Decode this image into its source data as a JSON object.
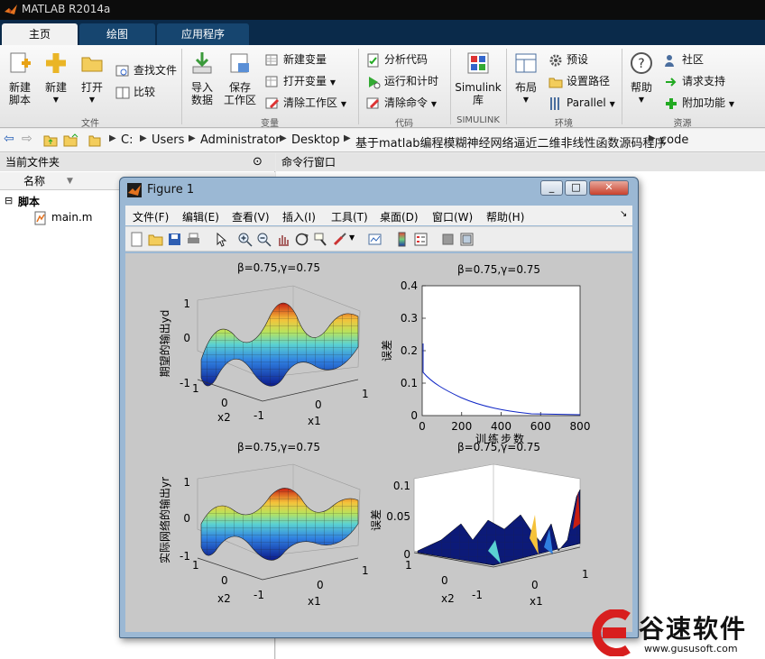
{
  "window": {
    "title": "MATLAB R2014a"
  },
  "tabs": [
    "主页",
    "绘图",
    "应用程序"
  ],
  "ribbon": {
    "new_script": "新建\n脚本",
    "new": "新建",
    "open": "打开",
    "find_files": "查找文件",
    "compare": "比较",
    "import_data": "导入\n数据",
    "save_workspace": "保存\n工作区",
    "new_variable": "新建变量",
    "open_variable": "打开变量",
    "clear_workspace": "清除工作区",
    "analyze_code": "分析代码",
    "run_and_time": "运行和计时",
    "clear_commands": "清除命令",
    "simulink_library": "Simulink\n库",
    "layout": "布局",
    "preferences": "预设",
    "set_path": "设置路径",
    "parallel": "Parallel",
    "help": "帮助",
    "community": "社区",
    "request_support": "请求支持",
    "add_ons": "附加功能",
    "groups": [
      "文件",
      "变量",
      "代码",
      "SIMULINK",
      "环境",
      "资源"
    ]
  },
  "address": {
    "segments": [
      "C:",
      "Users",
      "Administrator",
      "Desktop",
      "基于matlab编程模糊神经网络逼近二维非线性函数源码程序",
      "code"
    ]
  },
  "left_pane": {
    "title": "当前文件夹",
    "column_name": "名称",
    "group": "脚本",
    "file": "main.m"
  },
  "right_pane": {
    "title": "命令行窗口"
  },
  "figure": {
    "title": "Figure 1",
    "menus": [
      "文件(F)",
      "编辑(E)",
      "查看(V)",
      "插入(I)",
      "工具(T)",
      "桌面(D)",
      "窗口(W)",
      "帮助(H)"
    ],
    "plots": {
      "tl": {
        "title": "β=0.75,γ=0.75",
        "zlabel": "期望的输出yd",
        "xlabel": "x1",
        "ylabel": "x2",
        "zticks": [
          "1",
          "0",
          "-1"
        ],
        "x1ticks": [
          "-1",
          "0",
          "1"
        ],
        "x2ticks": [
          "1",
          "0",
          "-1"
        ]
      },
      "tr": {
        "title": "β=0.75,γ=0.75",
        "ylabel": "误差",
        "xlabel": "训练步数",
        "yticks": [
          "0.4",
          "0.3",
          "0.2",
          "0.1",
          "0"
        ],
        "xticks": [
          "0",
          "200",
          "400",
          "600",
          "800"
        ]
      },
      "bl": {
        "title": "β=0.75,γ=0.75",
        "zlabel": "实际网络的输出yr",
        "xlabel": "x1",
        "ylabel": "x2",
        "zticks": [
          "1",
          "0",
          "-1"
        ],
        "x1ticks": [
          "-1",
          "0",
          "1"
        ],
        "x2ticks": [
          "1",
          "0",
          "-1"
        ]
      },
      "br": {
        "title": "β=0.75,γ=0.75",
        "zlabel": "误差",
        "xlabel": "x1",
        "ylabel": "x2",
        "zticks": [
          "0.1",
          "0.05",
          "0"
        ],
        "x1ticks": [
          "-1",
          "0",
          "1"
        ],
        "x2ticks": [
          "1",
          "0",
          "-1"
        ]
      }
    }
  },
  "watermark": {
    "brand": "谷速软件",
    "url": "www.gususoft.com"
  },
  "colors": {
    "titlebar": "#0c0c0c",
    "tabstrip": "#0a2a4a",
    "accent": "#16456f"
  }
}
